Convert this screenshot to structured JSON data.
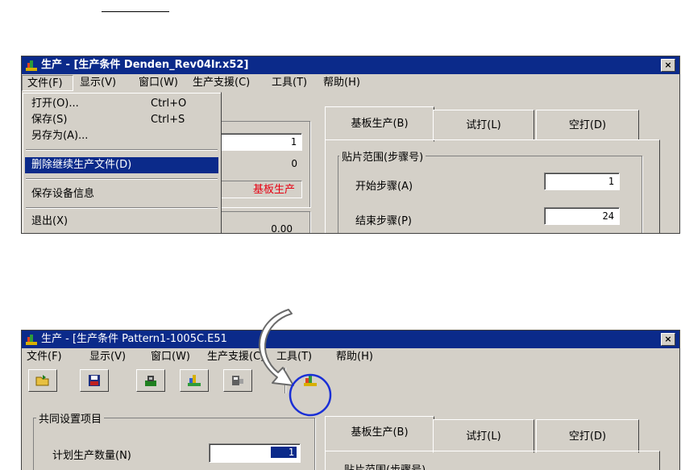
{
  "top": {
    "title": "生产 - [生产条件 Denden_Rev04lr.x52]",
    "close": "×",
    "menus": [
      "文件(F)",
      "显示(V)",
      "窗口(W)",
      "生产支援(C)",
      "工具(T)",
      "帮助(H)"
    ],
    "file_menu": {
      "open": "打开(O)...",
      "open_sc": "Ctrl+O",
      "save": "保存(S)",
      "save_sc": "Ctrl+S",
      "save_as": "另存为(A)...",
      "delete_continue": "删除继续生产文件(D)",
      "save_device_info": "保存设备信息",
      "exit": "退出(X)"
    },
    "value_1": "1",
    "value_0": "0",
    "board_status": "基板生产",
    "value_000": "0.00",
    "tabs": [
      "基板生产(B)",
      "试打(L)",
      "空打(D)"
    ],
    "range_group": "贴片范围(步骤号)",
    "start_step_label": "开始步骤(A)",
    "start_step_value": "1",
    "end_step_label": "结束步骤(P)",
    "end_step_value": "24"
  },
  "bottom": {
    "title": "生产 - [生产条件 Pattern1-1005C.E51",
    "close": "×",
    "menus": [
      "文件(F)",
      "显示(V)",
      "窗口(W)",
      "生产支援(C)",
      "工具(T)",
      "帮助(H)"
    ],
    "common_group": "共同设置项目",
    "plan_qty_label": "计划生产数量(N)",
    "plan_qty_value": "1",
    "tabs": [
      "基板生产(B)",
      "试打(L)",
      "空打(D)"
    ],
    "range_group_partial": "贴片范围(步骤号)"
  },
  "colors": {
    "titlebar": "#0b2a8a",
    "highlight": "#0b2a8a",
    "accent_red": "#e60012",
    "circle": "#1a2fd6"
  }
}
